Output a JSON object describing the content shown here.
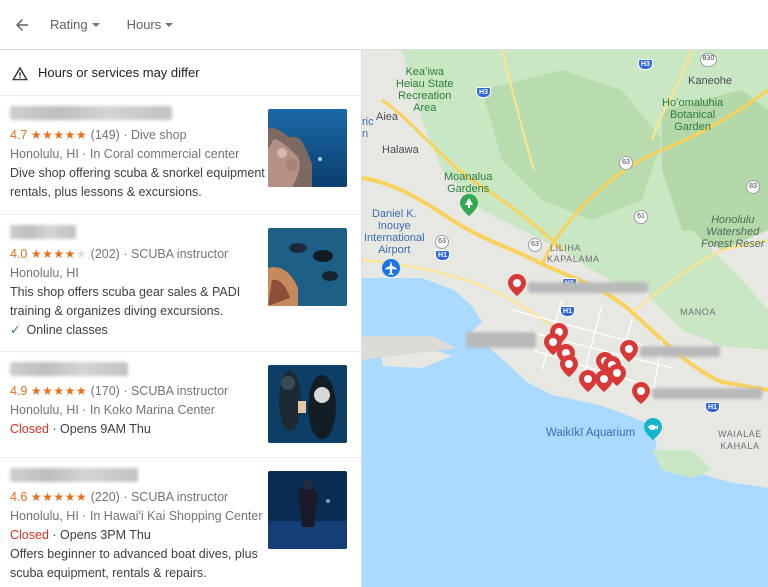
{
  "toolbar": {
    "back_icon": "arrow-left-icon",
    "filters": [
      {
        "label": "Rating"
      },
      {
        "label": "Hours"
      }
    ]
  },
  "notice": {
    "icon": "warning-icon",
    "text": "Hours or services may differ"
  },
  "results": [
    {
      "rating": "4.7",
      "rating_value": 4.7,
      "review_count": "(149)",
      "category": "Dive shop",
      "address": "Honolulu, HI · In Coral commercial center",
      "description": "Dive shop offering scuba & snorkel equipment rentals, plus lessons & excursions.",
      "status": "",
      "status_extra": "",
      "service": ""
    },
    {
      "rating": "4.0",
      "rating_value": 4.0,
      "review_count": "(202)",
      "category": "SCUBA instructor",
      "address": "Honolulu, HI",
      "description": "This shop offers scuba gear sales & PADI training & organizes diving excursions.",
      "status": "",
      "status_extra": "",
      "service": "Online classes"
    },
    {
      "rating": "4.9",
      "rating_value": 4.9,
      "review_count": "(170)",
      "category": "SCUBA instructor",
      "address": "Honolulu, HI · In Koko Marina Center",
      "description": "",
      "status": "Closed",
      "status_extra": "· Opens 9AM Thu",
      "service": ""
    },
    {
      "rating": "4.6",
      "rating_value": 4.6,
      "review_count": "(220)",
      "category": "SCUBA instructor",
      "address": "Honolulu, HI · In Hawai'i Kai Shopping Center",
      "description": "Offers beginner to advanced boat dives, plus scuba equipment, rentals & repairs.",
      "status": "Closed",
      "status_extra": "· Opens 3PM Thu",
      "service": ""
    }
  ],
  "map": {
    "labels": {
      "keaiwa": "Keaʻiwa\nHeiau State\nRecreation\nArea",
      "kaneohe": "Kaneohe",
      "hoomaluhia": "Hoʻomaluhia\nBotanical\nGarden",
      "aiea": "Aiea",
      "halawa": "Halawa",
      "moanalua": "Moanalua\nGardens",
      "airport": "Daniel K.\nInouye\nInternational\nAirport",
      "liliha": "LILIHA",
      "kapalama": "KAPALAMA",
      "honolulu_watershed": "Honolulu\nWatershed\nForest Reser",
      "manoa": "MANOA",
      "aquarium": "Waikīkī Aquarium",
      "waialae": "WAIALAE\nKAHALA",
      "ric": "ric\nn"
    },
    "shields": {
      "h3_a": "H3",
      "h3_b": "H3",
      "h1_a": "H1",
      "h1_b": "H1",
      "h1_c": "H1",
      "h1_d": "H1",
      "r830": "830",
      "r63_a": "63",
      "r63_b": "63",
      "r63_c": "63",
      "r61": "61",
      "r83": "83"
    },
    "water_color": "#aadaff",
    "land_color": "#e8e8e3",
    "park_color": "#c9e7c2",
    "pin_color": "#d93838"
  }
}
